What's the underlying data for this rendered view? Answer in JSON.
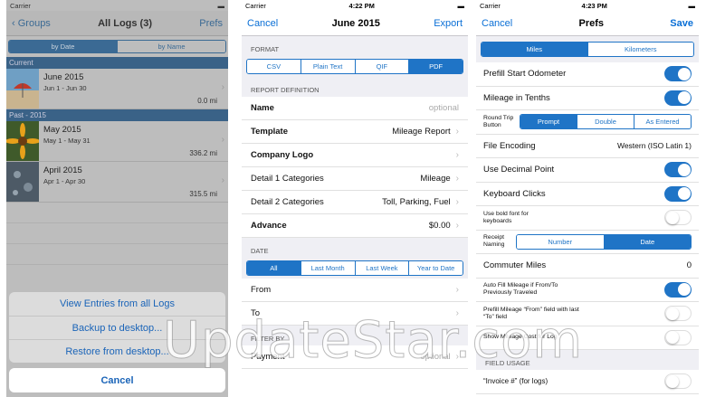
{
  "status": {
    "carrier": "Carrier",
    "s2_time": "4:22 PM",
    "s3_time": "4:23 PM"
  },
  "s1": {
    "nav": {
      "back": "Groups",
      "title": "All Logs (3)",
      "right": "Prefs"
    },
    "sort": [
      "by Date",
      "by Name"
    ],
    "sections": {
      "current": "Current",
      "past": "Past - 2015"
    },
    "logs": [
      {
        "name": "June 2015",
        "range": "Jun 1 - Jun 30",
        "dist": "0.0 mi"
      },
      {
        "name": "May 2015",
        "range": "May 1 - May 31",
        "dist": "336.2 mi"
      },
      {
        "name": "April 2015",
        "range": "Apr 1 - Apr 30",
        "dist": "315.5 mi"
      }
    ],
    "sheet": [
      "View Entries from all Logs",
      "Backup to desktop...",
      "Restore from desktop..."
    ],
    "cancel": "Cancel"
  },
  "s2": {
    "nav": {
      "left": "Cancel",
      "title": "June 2015",
      "right": "Export"
    },
    "format_hdr": "FORMAT",
    "formats": [
      "CSV",
      "Plain Text",
      "QIF",
      "PDF"
    ],
    "report_hdr": "REPORT DEFINITION",
    "rows": [
      {
        "label": "Name",
        "value": "optional"
      },
      {
        "label": "Template",
        "value": "Mileage Report"
      },
      {
        "label": "Company Logo",
        "value": ""
      },
      {
        "label": "Detail 1 Categories",
        "value": "Mileage"
      },
      {
        "label": "Detail 2 Categories",
        "value": "Toll, Parking, Fuel"
      },
      {
        "label": "Advance",
        "value": "$0.00"
      }
    ],
    "date_hdr": "DATE",
    "dates": [
      "All",
      "Last Month",
      "Last Week",
      "Year to Date"
    ],
    "date_rows": [
      {
        "label": "From"
      },
      {
        "label": "To"
      }
    ],
    "filter_hdr": "FILTER BY",
    "filter_row": {
      "label": "Payment",
      "value": "optional"
    }
  },
  "s3": {
    "nav": {
      "left": "Cancel",
      "title": "Prefs",
      "right": "Save"
    },
    "units": [
      "Miles",
      "Kilometers"
    ],
    "prefill_odo": "Prefill Start Odometer",
    "tenths": "Mileage in Tenths",
    "round_trip": {
      "label": "Round Trip Button",
      "options": [
        "Prompt",
        "Double",
        "As Entered"
      ]
    },
    "encoding": {
      "label": "File Encoding",
      "value": "Western (ISO Latin 1)"
    },
    "decimal": "Use Decimal Point",
    "clicks": "Keyboard Clicks",
    "bold_font": "Use bold font for keyboards",
    "receipt": {
      "label": "Receipt Naming",
      "options": [
        "Number",
        "Date"
      ]
    },
    "commuter": {
      "label": "Commuter Miles",
      "value": "0"
    },
    "autofill": "Auto Fill Mileage if From/To Previously Traveled",
    "prefill_from": "Prefill Mileage “From” field with last “To” field",
    "show_cost": "Show Mileage Cost for Log",
    "usage_hdr": "FIELD USAGE",
    "invoice": "“Invoice #” (for logs)"
  },
  "watermark": "UpdateStar.com",
  "colors": {
    "accent": "#1f74c6",
    "dim_accent": "#3a6287"
  }
}
